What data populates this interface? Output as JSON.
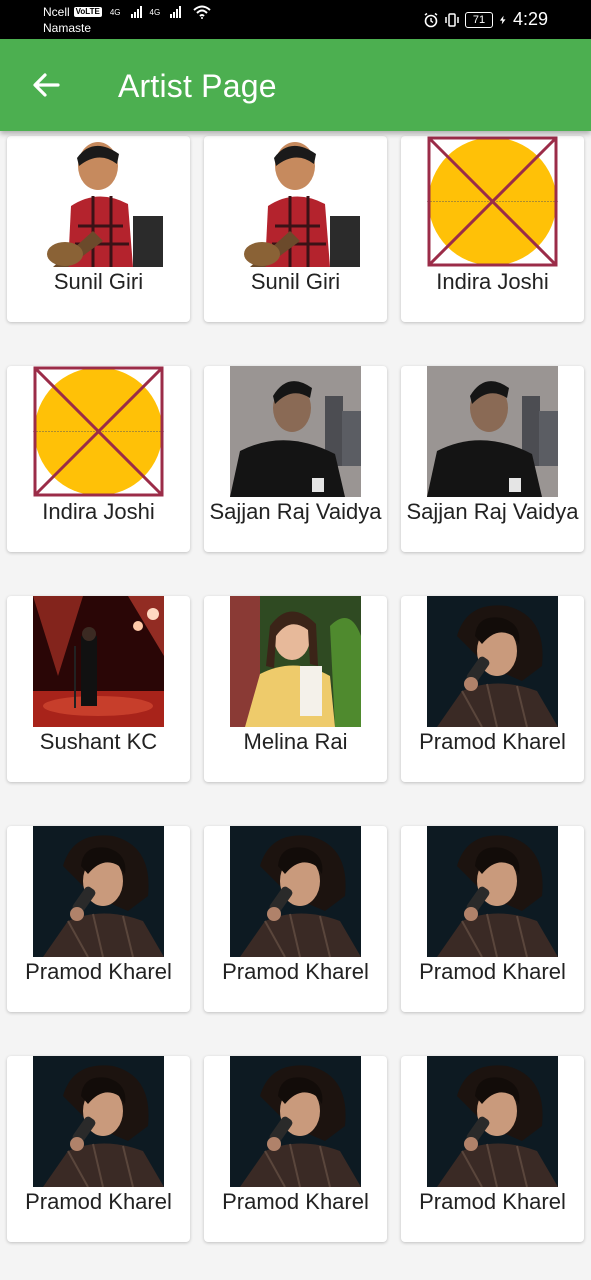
{
  "status_bar": {
    "carrier": "Ncell",
    "volte": "VoLTE",
    "network_name": "Namaste",
    "signal_1_label": "4G",
    "signal_2_label": "4G",
    "battery": "71",
    "time": "4:29"
  },
  "app_bar": {
    "title": "Artist Page",
    "back_icon": "arrow-back-icon"
  },
  "artists": [
    {
      "name": "Sunil Giri",
      "image": "guitar-photo"
    },
    {
      "name": "Sunil Giri",
      "image": "guitar-photo"
    },
    {
      "name": "Indira Joshi",
      "image": "broken-image-placeholder"
    },
    {
      "name": "Indira Joshi",
      "image": "broken-image-placeholder"
    },
    {
      "name": "Sajjan Raj Vaidya",
      "image": "city-portrait-photo"
    },
    {
      "name": "Sajjan Raj Vaidya",
      "image": "city-portrait-photo"
    },
    {
      "name": "Sushant KC",
      "image": "stage-photo"
    },
    {
      "name": "Melina Rai",
      "image": "garden-portrait-photo"
    },
    {
      "name": "Pramod Kharel",
      "image": "microphone-photo"
    },
    {
      "name": "Pramod Kharel",
      "image": "microphone-photo"
    },
    {
      "name": "Pramod Kharel",
      "image": "microphone-photo"
    },
    {
      "name": "Pramod Kharel",
      "image": "microphone-photo"
    },
    {
      "name": "Pramod Kharel",
      "image": "microphone-photo"
    },
    {
      "name": "Pramod Kharel",
      "image": "microphone-photo"
    },
    {
      "name": "Pramod Kharel",
      "image": "microphone-photo"
    }
  ],
  "colors": {
    "app_bar": "#4caf50",
    "background": "#f4f4f4",
    "placeholder_fill": "#ffc107",
    "placeholder_cross": "#9b2c48"
  }
}
